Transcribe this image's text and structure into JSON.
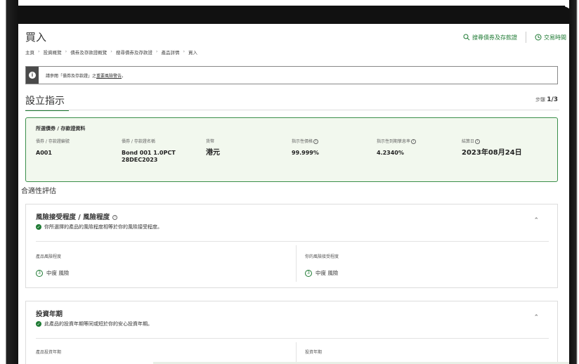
{
  "page": {
    "title": "買入",
    "top_links": {
      "search_label": "搜尋債券及存款證",
      "hours_label": "交易時間"
    },
    "breadcrumb": [
      "主頁",
      "投資概覽",
      "債券及存款證概覽",
      "搜尋債券及存款證",
      "產品詳情",
      "買入"
    ]
  },
  "alert": {
    "prefix": "請參閱「債券及存款證」之",
    "link": "重要風險警告",
    "suffix": "。"
  },
  "setup": {
    "title": "設立指示",
    "step_prefix": "步驟",
    "step_value": "1/3"
  },
  "selected": {
    "heading": "所選債券 / 存款證資料",
    "columns": [
      {
        "label": "債券 / 存款證編號",
        "value": "A001"
      },
      {
        "label": "債券 / 存款證名稱",
        "value": "Bond 001 1.0PCT 28DEC2023"
      },
      {
        "label": "貨幣",
        "value": "港元"
      },
      {
        "label": "指示性價格",
        "value": "99.999%"
      },
      {
        "label": "指示性到期孳息率",
        "value": "4.2340%"
      },
      {
        "label": "結算日",
        "value": "2023年08月24日"
      }
    ]
  },
  "suitability": {
    "title": "合適性評估",
    "risk_card": {
      "title": "風險接受程度 / 風險程度",
      "subtitle": "你所選擇的產品的風險程度相等於你的風險接受程度。",
      "product_label": "產品風險程度",
      "product_level": "3",
      "product_value": "中度 風險",
      "your_label": "你的風險接受程度",
      "your_level": "3",
      "your_value": "中度 風險"
    },
    "tenor_card": {
      "title": "投資年期",
      "subtitle": "此產品的投資年期等同或短於你的安心投資年期。",
      "product_label": "產品投資年期",
      "your_label": "投資年期"
    }
  },
  "colors": {
    "accent": "#1e7a33",
    "selected_bg": "#f2f8ee",
    "selected_border": "#3a8f4a"
  }
}
